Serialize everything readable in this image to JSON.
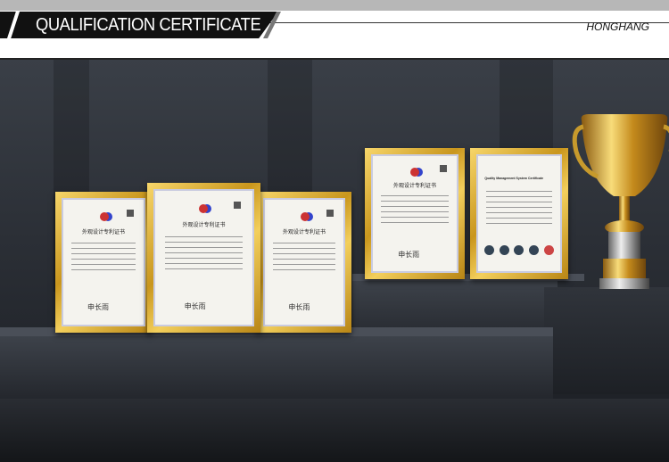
{
  "header": {
    "title": "QUALIFICATION CERTIFICATE",
    "brand": "HONGHANG"
  },
  "certificates": [
    {
      "type": "design-patent",
      "title": "外观设计专利证书"
    },
    {
      "type": "design-patent",
      "title": "外观设计专利证书"
    },
    {
      "type": "design-patent",
      "title": "外观设计专利证书"
    },
    {
      "type": "design-patent",
      "title": "外观设计专利证书"
    },
    {
      "type": "quality",
      "title": "Quality Management System Certificate"
    }
  ],
  "colors": {
    "gold": "#d4a52a",
    "background": "#2b2f36"
  }
}
